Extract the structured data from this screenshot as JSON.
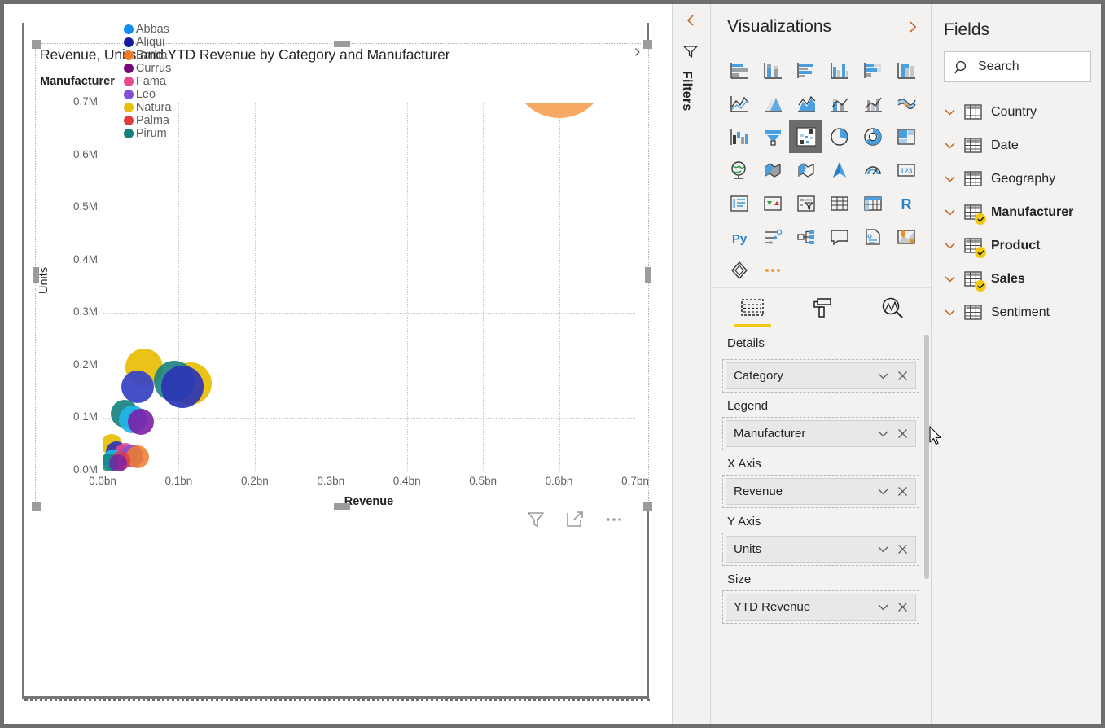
{
  "window": {
    "frame_color": "#6e6e6e"
  },
  "visual": {
    "title": "Revenue, Units and YTD Revenue by Category and Manufacturer",
    "legend_title": "Manufacturer",
    "legend_next_icon": "chevron-right-icon",
    "footer_icons": [
      {
        "name": "filter-icon",
        "label": "Filters"
      },
      {
        "name": "focus-mode-icon",
        "label": "Focus mode"
      },
      {
        "name": "more-options-icon",
        "label": "More options"
      }
    ]
  },
  "chart_data": {
    "type": "scatter",
    "title": "Revenue, Units and YTD Revenue by Category and Manufacturer",
    "xlabel": "Revenue",
    "ylabel": "Units",
    "xlim": [
      0,
      0.7
    ],
    "ylim": [
      0,
      0.7
    ],
    "xticks": [
      "0.0bn",
      "0.1bn",
      "0.2bn",
      "0.3bn",
      "0.4bn",
      "0.5bn",
      "0.6bn",
      "0.7bn"
    ],
    "yticks": [
      "0.0M",
      "0.1M",
      "0.2M",
      "0.3M",
      "0.4M",
      "0.5M",
      "0.6M",
      "0.7M"
    ],
    "grid": true,
    "legend_position": "top",
    "size_field": "YTD Revenue",
    "legend": [
      {
        "name": "Abbas",
        "color": "#0d8ef0"
      },
      {
        "name": "Aliqui",
        "color": "#1a1a9e"
      },
      {
        "name": "Barba",
        "color": "#ef7c2b"
      },
      {
        "name": "Currus",
        "color": "#730a7a"
      },
      {
        "name": "Fama",
        "color": "#e8478e"
      },
      {
        "name": "Leo",
        "color": "#7f4fd6"
      },
      {
        "name": "Natura",
        "color": "#e8c00b"
      },
      {
        "name": "Palma",
        "color": "#e03c3c"
      },
      {
        "name": "Pirum",
        "color": "#13807d"
      }
    ],
    "points": [
      {
        "manufacturer": "Barba",
        "x": 0.6,
        "y": 0.76,
        "size": 58,
        "color": "#f7a963",
        "opacity": 1.0
      },
      {
        "manufacturer": "Natura",
        "x": 0.055,
        "y": 0.196,
        "size": 23,
        "color": "#e8c00b",
        "opacity": 0.95
      },
      {
        "manufacturer": "Natura",
        "x": 0.116,
        "y": 0.166,
        "size": 26,
        "color": "#e8c00b",
        "opacity": 0.95
      },
      {
        "manufacturer": "Pirum",
        "x": 0.094,
        "y": 0.17,
        "size": 25,
        "color": "#13807d",
        "opacity": 0.88
      },
      {
        "manufacturer": "Aliqui",
        "x": 0.105,
        "y": 0.16,
        "size": 26,
        "color": "#2b35b5",
        "opacity": 0.92
      },
      {
        "manufacturer": "Aliqui",
        "x": 0.046,
        "y": 0.16,
        "size": 20,
        "color": "#3b46c4",
        "opacity": 0.95
      },
      {
        "manufacturer": "Pirum",
        "x": 0.029,
        "y": 0.108,
        "size": 17,
        "color": "#13807d",
        "opacity": 0.9
      },
      {
        "manufacturer": "Abbas",
        "x": 0.04,
        "y": 0.097,
        "size": 17,
        "color": "#1fb6e8",
        "opacity": 0.92
      },
      {
        "manufacturer": "Currus",
        "x": 0.05,
        "y": 0.093,
        "size": 16,
        "color": "#7b1fa8",
        "opacity": 0.9
      },
      {
        "manufacturer": "Natura",
        "x": 0.012,
        "y": 0.05,
        "size": 13,
        "color": "#e8c00b",
        "opacity": 0.95
      },
      {
        "manufacturer": "Aliqui",
        "x": 0.018,
        "y": 0.035,
        "size": 13,
        "color": "#2b35b5",
        "opacity": 0.92
      },
      {
        "manufacturer": "Fama",
        "x": 0.03,
        "y": 0.031,
        "size": 14,
        "color": "#e8478e",
        "opacity": 0.88
      },
      {
        "manufacturer": "Leo",
        "x": 0.038,
        "y": 0.028,
        "size": 14,
        "color": "#7f4fd6",
        "opacity": 0.85
      },
      {
        "manufacturer": "Barba",
        "x": 0.046,
        "y": 0.026,
        "size": 14,
        "color": "#ef7c2b",
        "opacity": 0.85
      },
      {
        "manufacturer": "Abbas",
        "x": 0.014,
        "y": 0.02,
        "size": 13,
        "color": "#1fb6e8",
        "opacity": 0.9
      },
      {
        "manufacturer": "Palma",
        "x": 0.024,
        "y": 0.018,
        "size": 12,
        "color": "#e03c3c",
        "opacity": 0.8
      },
      {
        "manufacturer": "Pirum",
        "x": 0.009,
        "y": 0.016,
        "size": 11,
        "color": "#13807d",
        "opacity": 0.85
      },
      {
        "manufacturer": "Currus",
        "x": 0.02,
        "y": 0.014,
        "size": 11,
        "color": "#7b1fa8",
        "opacity": 0.8
      }
    ]
  },
  "filters_rail": {
    "collapse_icon": "chevron-left-icon",
    "funnel_icon": "filter-icon",
    "label": "Filters"
  },
  "visualizations": {
    "title": "Visualizations",
    "expand_icon": "chevron-right-icon",
    "icons": [
      "stacked-bar-chart-icon",
      "stacked-column-chart-icon",
      "clustered-bar-chart-icon",
      "clustered-column-chart-icon",
      "hundred-percent-stacked-bar-chart-icon",
      "hundred-percent-stacked-column-chart-icon",
      "line-chart-icon",
      "area-chart-icon",
      "stacked-area-chart-icon",
      "line-stacked-column-chart-icon",
      "line-clustered-column-chart-icon",
      "ribbon-chart-icon",
      "waterfall-chart-icon",
      "funnel-chart-icon",
      "scatter-chart-icon",
      "pie-chart-icon",
      "donut-chart-icon",
      "treemap-icon",
      "map-icon",
      "filled-map-icon",
      "shape-map-icon",
      "arcgis-map-icon",
      "gauge-icon",
      "card-icon",
      "multi-row-card-icon",
      "kpi-icon",
      "slicer-icon",
      "table-icon",
      "matrix-icon",
      "r-script-visual-icon",
      "python-visual-icon",
      "key-influencers-icon",
      "decomposition-tree-icon",
      "qa-visual-icon",
      "smart-narrative-icon",
      "paginated-report-icon",
      "power-apps-icon",
      "more-visuals-icon"
    ],
    "selected_icon": "scatter-chart-icon",
    "tabs": [
      {
        "name": "fields-tab",
        "icon": "fields-icon",
        "active": true
      },
      {
        "name": "format-tab",
        "icon": "paint-roller-icon",
        "active": false
      },
      {
        "name": "analytics-tab",
        "icon": "analytics-magnifier-icon",
        "active": false
      }
    ],
    "tab_caption": "Details",
    "wells": [
      {
        "label": "",
        "value": "Category",
        "name": "details-well"
      },
      {
        "label": "Legend",
        "value": "Manufacturer",
        "name": "legend-well"
      },
      {
        "label": "X Axis",
        "value": "Revenue",
        "name": "x-axis-well"
      },
      {
        "label": "Y Axis",
        "value": "Units",
        "name": "y-axis-well"
      },
      {
        "label": "Size",
        "value": "YTD Revenue",
        "name": "size-well"
      }
    ],
    "pill_dropdown_icon": "chevron-down-icon",
    "pill_remove_icon": "close-icon"
  },
  "fields": {
    "title": "Fields",
    "search_placeholder": "Search",
    "search_icon": "search-icon",
    "tables": [
      {
        "name": "Country",
        "used": false
      },
      {
        "name": "Date",
        "used": false
      },
      {
        "name": "Geography",
        "used": false
      },
      {
        "name": "Manufacturer",
        "used": true
      },
      {
        "name": "Product",
        "used": true
      },
      {
        "name": "Sales",
        "used": true
      },
      {
        "name": "Sentiment",
        "used": false
      }
    ],
    "expand_icon": "chevron-down-icon",
    "table_icon": "table-icon",
    "used_badge_icon": "check-badge-icon",
    "accent_color": "#f2c811"
  }
}
